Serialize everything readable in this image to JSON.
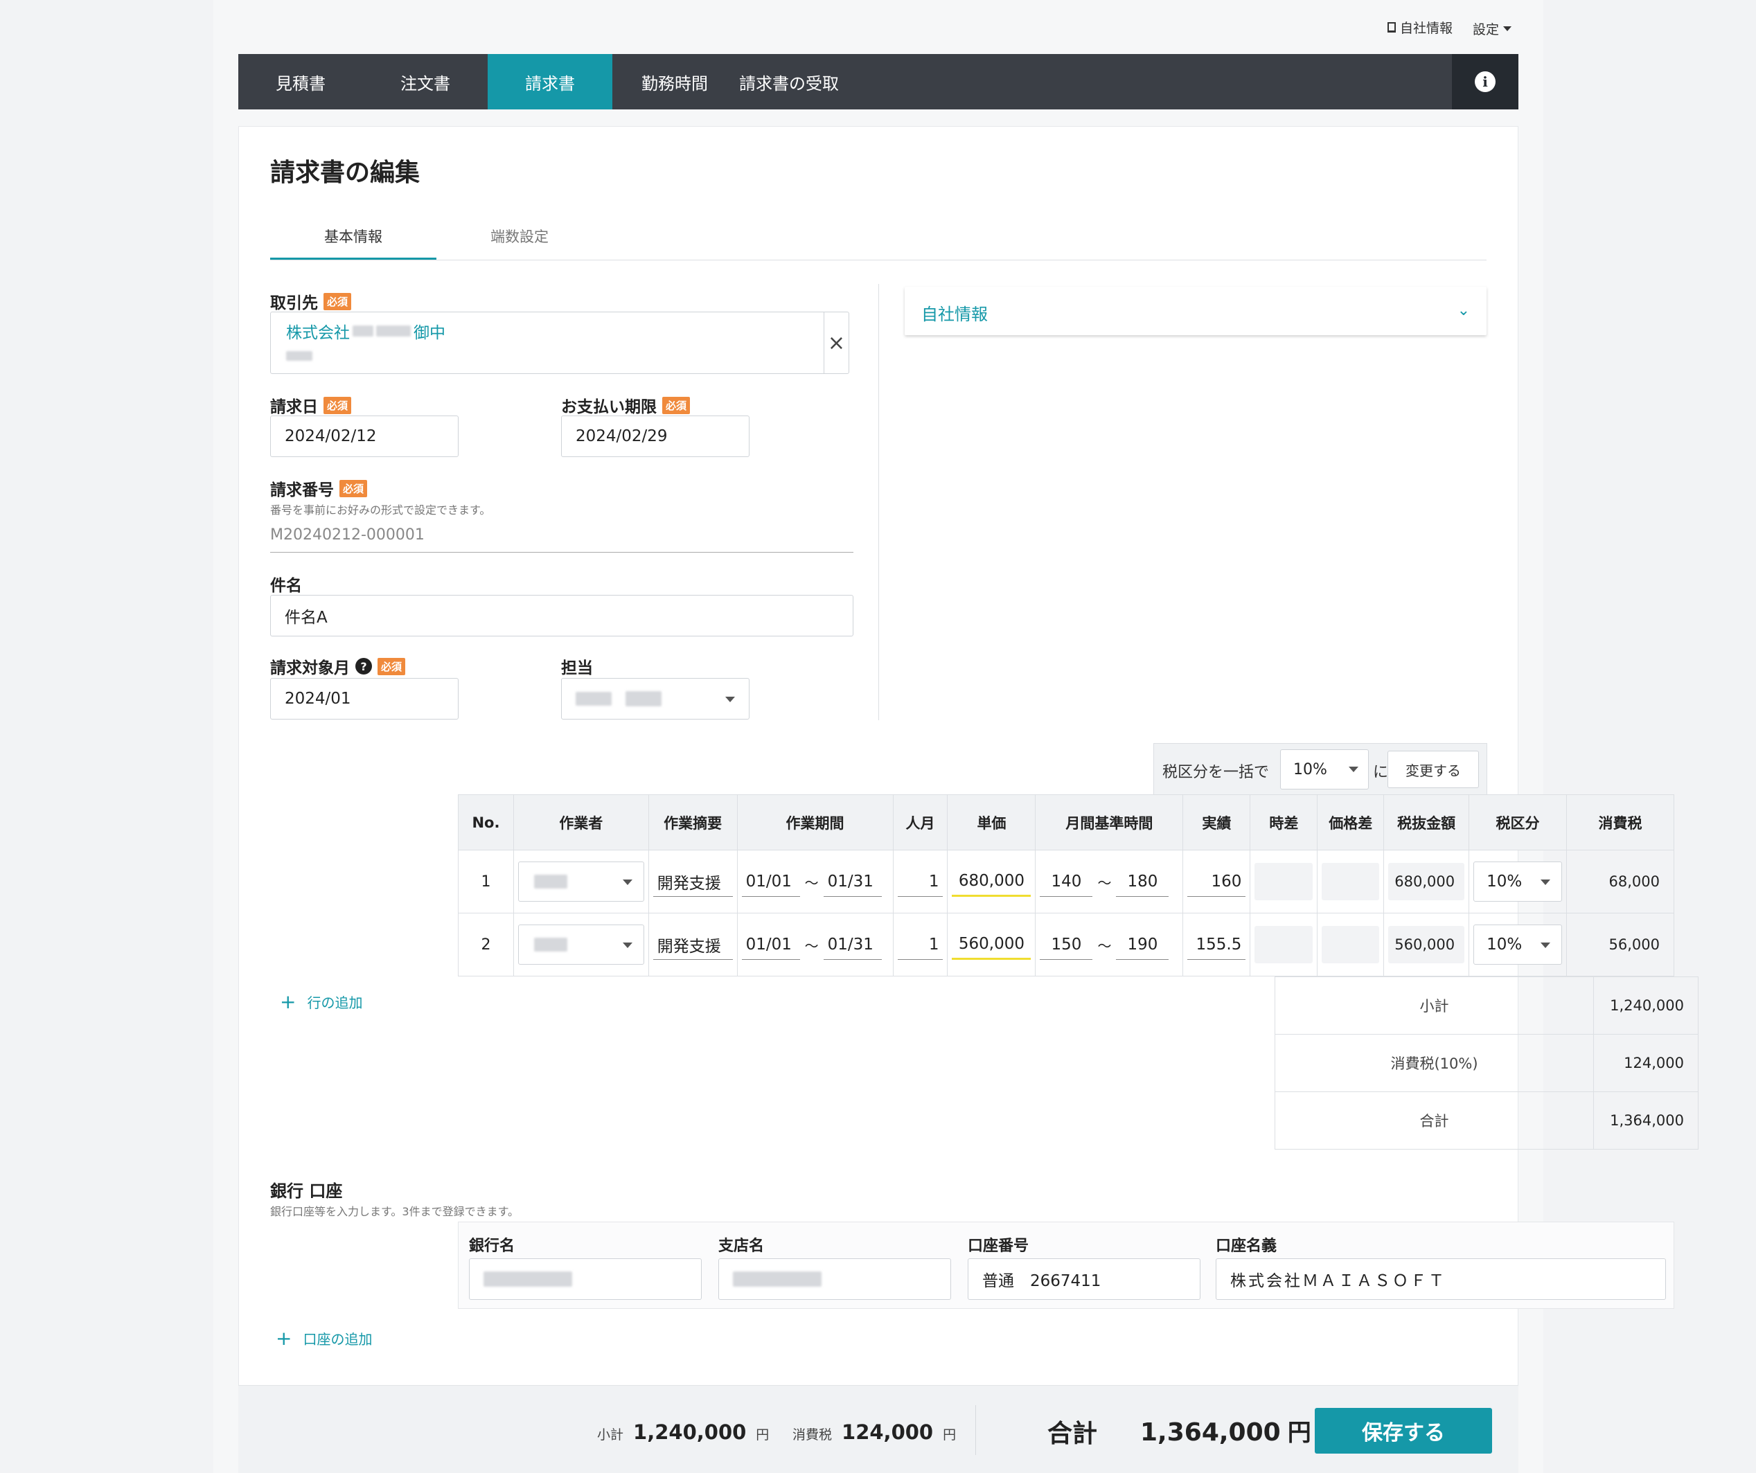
{
  "topbar": {
    "company_info": "自社情報",
    "settings": "設定"
  },
  "nav": {
    "items": [
      "見積書",
      "注文書",
      "請求書",
      "勤務時間",
      "請求書の受取"
    ],
    "active": "請求書"
  },
  "page_title": "請求書の編集",
  "tabs": [
    "基本情報",
    "端数設定"
  ],
  "required_badge": "必須",
  "form": {
    "client": {
      "label": "取引先",
      "value_prefix": "株式会社",
      "value_suffix": "御中"
    },
    "invoice_date": {
      "label": "請求日",
      "value": "2024/02/12"
    },
    "due_date": {
      "label": "お支払い期限",
      "value": "2024/02/29"
    },
    "invoice_number": {
      "label": "請求番号",
      "hint": "番号を事前にお好みの形式で設定できます。",
      "value": "M20240212-000001"
    },
    "subject": {
      "label": "件名",
      "value": "件名A"
    },
    "target_month": {
      "label": "請求対象月",
      "value": "2024/01"
    },
    "assignee": {
      "label": "担当"
    }
  },
  "company_panel": {
    "title": "自社情報"
  },
  "bulk_tax": {
    "label": "税区分を一括で",
    "value": "10%",
    "suffix": "に",
    "button": "変更する"
  },
  "table": {
    "headers": [
      "No.",
      "作業者",
      "作業摘要",
      "作業期間",
      "人月",
      "単価",
      "月間基準時間",
      "実績",
      "時差",
      "価格差",
      "税抜金額",
      "税区分",
      "消費税"
    ],
    "rows": [
      {
        "no": "1",
        "summary": "開発支援",
        "from": "01/01",
        "tilde": "～",
        "to": "01/31",
        "mm": "1",
        "price": "680,000",
        "base_min": "140",
        "base_max": "180",
        "actual": "160",
        "amount": "680,000",
        "tax_rate": "10%",
        "tax": "68,000"
      },
      {
        "no": "2",
        "summary": "開発支援",
        "from": "01/01",
        "tilde": "～",
        "to": "01/31",
        "mm": "1",
        "price": "560,000",
        "base_min": "150",
        "base_max": "190",
        "actual": "155.5",
        "amount": "560,000",
        "tax_rate": "10%",
        "tax": "56,000"
      }
    ],
    "add_row": "行の追加"
  },
  "summary": {
    "subtotal_label": "小計",
    "subtotal": "1,240,000",
    "tax_label": "消費税(10%)",
    "tax": "124,000",
    "total_label": "合計",
    "total": "1,364,000"
  },
  "bank": {
    "title": "銀行 口座",
    "hint": "銀行口座等を入力します。3件まで登録できます。",
    "bank_name_label": "銀行名",
    "branch_label": "支店名",
    "account_no_label": "口座番号",
    "account_no_value": "普通　2667411",
    "holder_label": "口座名義",
    "holder_value": "株式会社ＭＡＩＡＳＯＦＴ",
    "add": "口座の追加"
  },
  "footer": {
    "subtotal_label": "小計",
    "subtotal": "1,240,000",
    "tax_label": "消費税",
    "tax": "124,000",
    "yen": "円",
    "total_label": "合計",
    "total": "1,364,000",
    "total_yen": "円",
    "save": "保存する"
  }
}
